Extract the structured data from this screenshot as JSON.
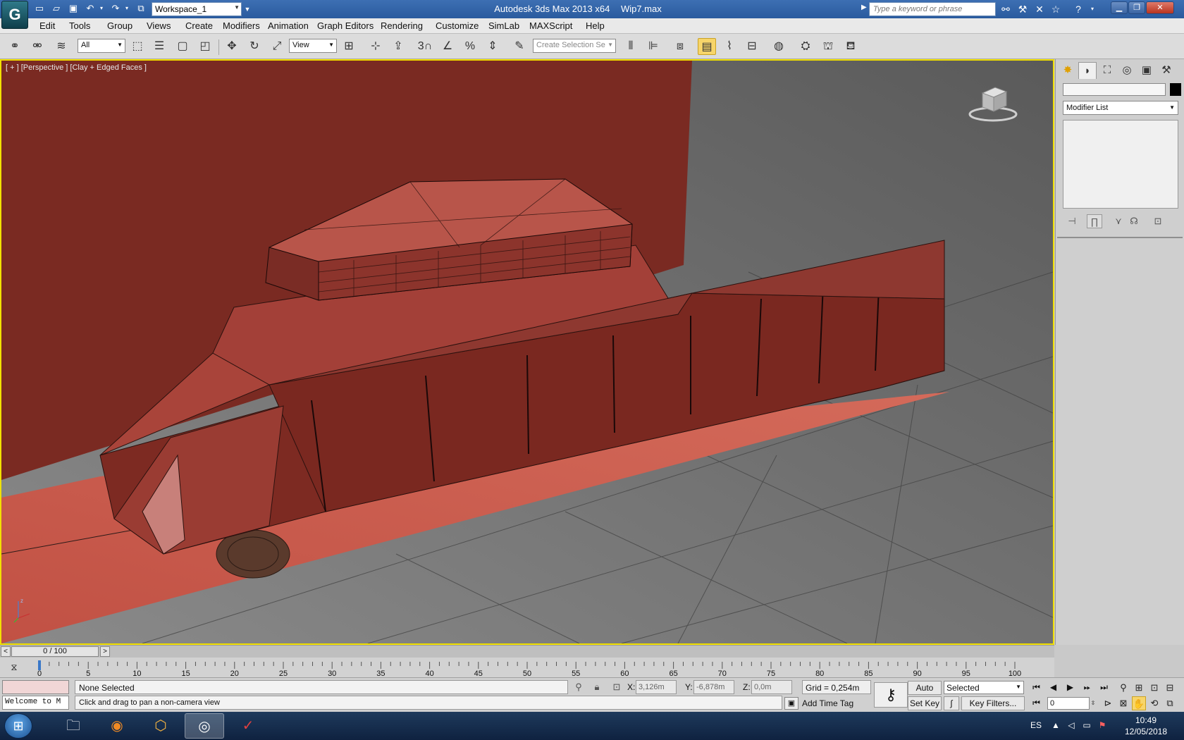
{
  "titlebar": {
    "workspace": "Workspace_1",
    "app_name": "Autodesk 3ds Max  2013 x64",
    "file_name": "Wip7.max",
    "search_placeholder": "Type a keyword or phrase"
  },
  "menu": [
    "Edit",
    "Tools",
    "Group",
    "Views",
    "Create",
    "Modifiers",
    "Animation",
    "Graph Editors",
    "Rendering",
    "Customize",
    "SimLab",
    "MAXScript",
    "Help"
  ],
  "toolbar": {
    "selection_filter": "All",
    "ref_coord": "View",
    "named_selection_placeholder": "Create Selection Se",
    "snap_label": "3"
  },
  "viewport": {
    "label": "[ + ] [Perspective ] [Clay + Edged Faces ]"
  },
  "command_panel": {
    "modifier_list": "Modifier List"
  },
  "timeline": {
    "frame_display": "0 / 100",
    "ticks": [
      "0",
      "5",
      "10",
      "15",
      "20",
      "25",
      "30",
      "35",
      "40",
      "45",
      "50",
      "55",
      "60",
      "65",
      "70",
      "75",
      "80",
      "85",
      "90",
      "95",
      "100"
    ]
  },
  "status": {
    "listener": "Welcome to M",
    "selection": "None Selected",
    "prompt": "Click and drag to pan a non-camera view",
    "x_label": "X:",
    "x_value": "3,126m",
    "y_label": "Y:",
    "y_value": "-6,878m",
    "z_label": "Z:",
    "z_value": "0,0m",
    "grid": "Grid = 0,254m",
    "add_time_tag": "Add Time Tag",
    "auto_key": "Auto Key",
    "set_key": "Set Key",
    "key_filters": "Key Filters...",
    "selected_option": "Selected",
    "current_frame": "0"
  },
  "taskbar": {
    "language": "ES",
    "time": "10:49",
    "date": "12/05/2018"
  },
  "colors": {
    "viewport_border": "#f1e000",
    "clay_dark": "#7a2a22",
    "clay_light": "#c4584a",
    "title_blue": "#2f62a8"
  }
}
